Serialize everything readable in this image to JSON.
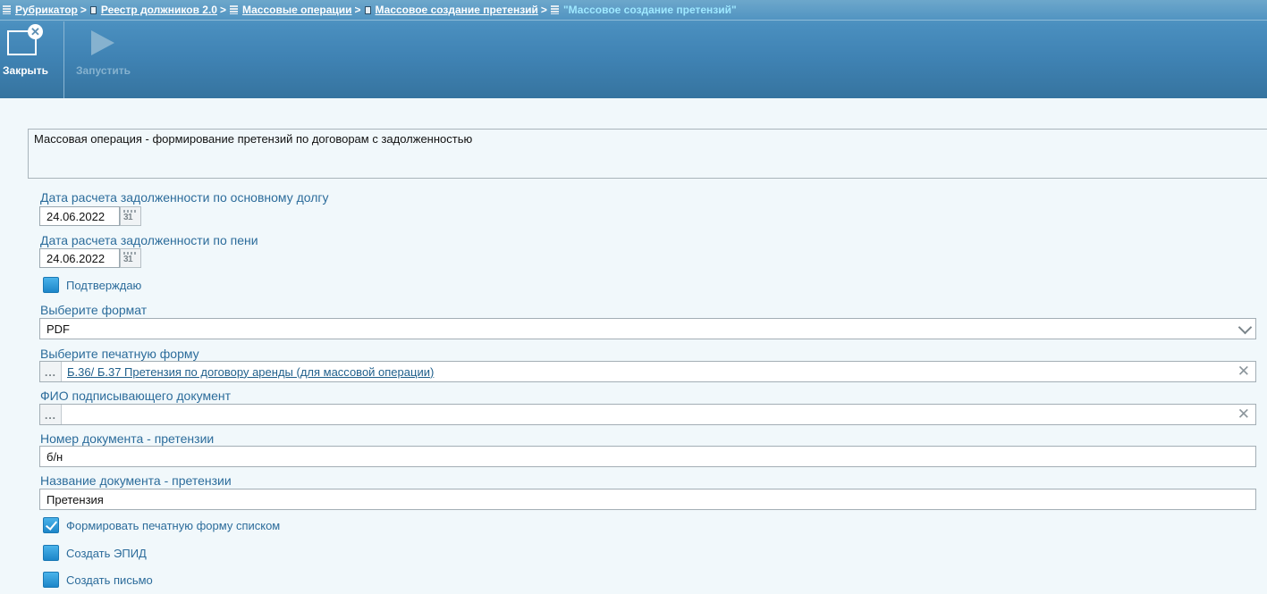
{
  "breadcrumb": {
    "items": [
      {
        "label": "Рубрикатор",
        "icon": "list-icon"
      },
      {
        "label": "Реестр должников 2.0",
        "icon": "document-icon"
      },
      {
        "label": "Массовые операции",
        "icon": "list-icon"
      },
      {
        "label": "Массовое создание претензий",
        "icon": "document-icon"
      }
    ],
    "separator": ">",
    "current": "\"Массовое создание претензий\""
  },
  "toolbar": {
    "close_label": "Закрыть",
    "run_label": "Запустить"
  },
  "form": {
    "description": "Массовая операция - формирование претензий по договорам с задолженностью",
    "debt_date": {
      "label": "Дата расчета задолженности по основному долгу",
      "value": "24.06.2022"
    },
    "penalty_date": {
      "label": "Дата расчета задолженности по пени",
      "value": "24.06.2022"
    },
    "calendar_glyph": "31",
    "confirm": {
      "label": "Подтверждаю",
      "checked": false
    },
    "format": {
      "label": "Выберите формат",
      "value": "PDF"
    },
    "print_form": {
      "label": "Выберите печатную форму",
      "value": "Б.36/ Б.37 Претензия по договору аренды (для массовой операции)"
    },
    "signer": {
      "label": "ФИО подписывающего документ",
      "value": ""
    },
    "doc_number": {
      "label": "Номер документа - претензии",
      "value": "б/н"
    },
    "doc_name": {
      "label": "Название документа - претензии",
      "value": "Претензия"
    },
    "print_as_list": {
      "label": "Формировать печатную форму списком",
      "checked": true
    },
    "create_epid": {
      "label": "Создать ЭПИД",
      "checked": false
    },
    "create_letter": {
      "label": "Создать письмо",
      "checked": false
    },
    "picker_glyph": "...",
    "clear_glyph": "✕"
  }
}
